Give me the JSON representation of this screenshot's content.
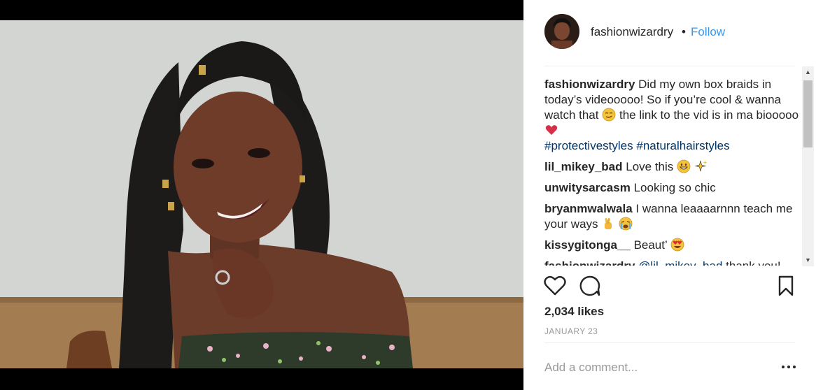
{
  "post": {
    "username": "fashionwizardry",
    "separator": "•",
    "follow_label": "Follow",
    "caption": {
      "user": "fashionwizardry",
      "text_part1": "Did my own box braids in today’s videooooo! So if you’re cool & wanna watch that",
      "text_part2": "the link to the vid is in ma biooooo",
      "hashtag1": "#protectivestyles",
      "hashtag2": "#naturalhairstyles"
    },
    "comments": [
      {
        "user": "lil_mikey_bad",
        "text": "Love this"
      },
      {
        "user": "unwitysarcasm",
        "text": "Looking so chic"
      },
      {
        "user": "bryanmwalwala",
        "text": "I wanna leaaaarnnn teach me your ways"
      },
      {
        "user": "kissygitonga__",
        "text": "Beaut’"
      },
      {
        "user": "fashionwizardry",
        "mention": "@lil_mikey_bad",
        "text": "thank you!"
      }
    ],
    "likes": "2,034 likes",
    "date": "JANUARY 23",
    "add_comment_placeholder": "Add a comment..."
  },
  "icons": [
    "heart-icon",
    "comment-icon",
    "bookmark-icon",
    "more-options-icon",
    "scroll-up-icon",
    "scroll-down-icon"
  ],
  "colors": {
    "link": "#3897f0",
    "hashtag": "#003569",
    "meta": "#999999",
    "text": "#262626"
  }
}
